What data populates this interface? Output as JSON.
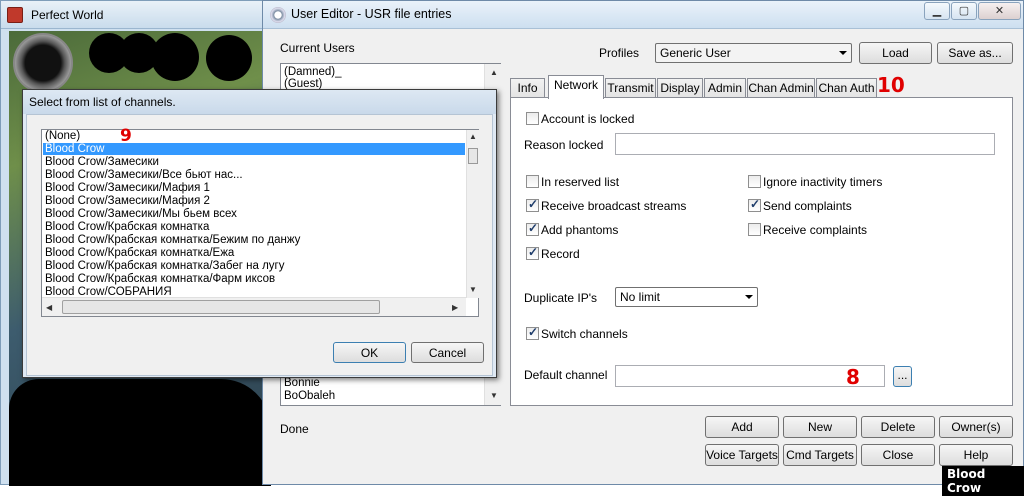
{
  "background_window": {
    "title": "Perfect World"
  },
  "editor": {
    "title": "User Editor - USR file entries",
    "current_users_label": "Current Users",
    "users_top": [
      "(Damned)_",
      "(Guest)"
    ],
    "users_bottom": [
      "Bonnie",
      "BoObaleh"
    ],
    "profiles_label": "Profiles",
    "profile_value": "Generic User",
    "load_label": "Load",
    "save_as_label": "Save as...",
    "tabs": [
      "Info",
      "Network",
      "Transmit",
      "Display",
      "Admin",
      "Chan Admin",
      "Chan Auth"
    ],
    "active_tab": "Network",
    "status_text": "Done",
    "buttons_row1": [
      "Add",
      "New",
      "Delete",
      "Owner(s)"
    ],
    "buttons_row2": [
      "Voice Targets",
      "Cmd Targets",
      "Close",
      "Help"
    ]
  },
  "network": {
    "account_locked": "Account is locked",
    "reason_locked_label": "Reason locked",
    "reason_locked_value": "",
    "in_reserved_list": "In reserved list",
    "receive_broadcast": "Receive broadcast streams",
    "add_phantoms": "Add phantoms",
    "record": "Record",
    "ignore_inactivity": "Ignore inactivity timers",
    "send_complaints": "Send complaints",
    "receive_complaints": "Receive complaints",
    "duplicate_ips_label": "Duplicate IP's",
    "duplicate_ips_value": "No limit",
    "switch_channels": "Switch channels",
    "default_channel_label": "Default channel",
    "default_channel_value": "",
    "browse_label": "..."
  },
  "annotations": {
    "dialog_marker": "9",
    "default_channel_marker": "8",
    "tabs_marker": "10"
  },
  "dialog": {
    "title": "Select from list of channels.",
    "channels": [
      "(None)",
      "Blood Crow",
      "Blood Crow/Замесики",
      "Blood Crow/Замесики/Все бьют нас...",
      "Blood Crow/Замесики/Мафия 1",
      "Blood Crow/Замесики/Мафия 2",
      "Blood Crow/Замесики/Мы бьем всех",
      "Blood Crow/Крабская комнатка",
      "Blood Crow/Крабская комнатка/Бежим по данжу",
      "Blood Crow/Крабская комнатка/Ежа",
      "Blood Crow/Крабская комнатка/Забег на лугу",
      "Blood Crow/Крабская комнатка/Фарм иксов",
      "Blood Crow/СОБРАНИЯ"
    ],
    "selected_index": 1,
    "ok_label": "OK",
    "cancel_label": "Cancel"
  },
  "watermark": "Blood Crow"
}
